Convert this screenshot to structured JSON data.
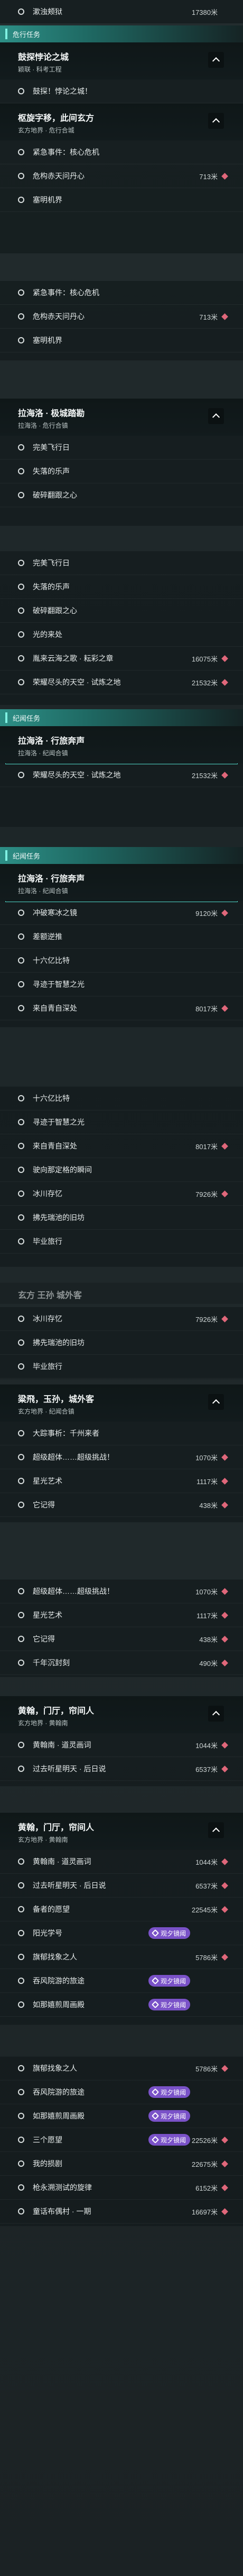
{
  "top": {
    "label": "漱浊颊狱",
    "distance": "17380米"
  },
  "cat1": "危行任务",
  "s1": {
    "title": "鼓探悖论之城",
    "sub": "颖联 · 科考工程",
    "item": "鼓探！悖论之城！"
  },
  "s2": {
    "title": "枢旋字移，此间玄方",
    "sub": "玄方地界 · 危行合城",
    "items": [
      {
        "label": "紧急事件：核心危机",
        "dist": ""
      },
      {
        "label": "危构赤天问丹心",
        "dist": "713米"
      },
      {
        "label": "塞明机界",
        "dist": ""
      }
    ]
  },
  "s2b": {
    "items": [
      {
        "label": "紧急事件：核心危机",
        "dist": ""
      },
      {
        "label": "危构赤天问丹心",
        "dist": "713米"
      },
      {
        "label": "塞明机界",
        "dist": ""
      }
    ]
  },
  "s3": {
    "title": "拉海洛 · 极城踏勘",
    "sub": "拉海洛 · 危行合镇",
    "items": [
      {
        "label": "完美飞行日",
        "dist": ""
      },
      {
        "label": "失落的乐声",
        "dist": ""
      },
      {
        "label": "破碎翻跟之心",
        "dist": ""
      }
    ]
  },
  "s3b": {
    "items": [
      {
        "label": "完美飞行日",
        "dist": ""
      },
      {
        "label": "失落的乐声",
        "dist": ""
      },
      {
        "label": "破碎翻跟之心",
        "dist": ""
      },
      {
        "label": "光的来处",
        "dist": ""
      },
      {
        "label": "胤来云海之歌 · 耘彩之章",
        "dist": "16075米"
      },
      {
        "label": "荣耀尽头的天空 · 试炼之地",
        "dist": "21532米"
      }
    ]
  },
  "cat2": "纪闻任务",
  "s4": {
    "title": "拉海洛 · 行旅奔声",
    "sub": "拉海洛 · 纪闻合镇",
    "items": [
      {
        "label": "荣耀尽头的天空 · 试炼之地",
        "dist": "21532米"
      }
    ]
  },
  "cat3": "纪闻任务",
  "s5": {
    "title": "拉海洛 · 行旅奔声",
    "sub": "拉海洛 · 纪闻合镇",
    "items": [
      {
        "label": "冲破寒冰之镜",
        "dist": "9120米"
      },
      {
        "label": "差额逆推",
        "dist": ""
      },
      {
        "label": "十六亿比特",
        "dist": ""
      },
      {
        "label": "寻迹于智慧之光",
        "dist": ""
      },
      {
        "label": "来自青自深处",
        "dist": "8017米"
      }
    ]
  },
  "s5b": {
    "items": [
      {
        "label": "十六亿比特",
        "dist": ""
      },
      {
        "label": "寻迹于智慧之光",
        "dist": ""
      },
      {
        "label": "来自青自深处",
        "dist": "8017米"
      },
      {
        "label": "驶向那定格的瞬间",
        "dist": ""
      },
      {
        "label": "冰川存忆",
        "dist": "7926米"
      },
      {
        "label": "拂先瑞池的旧坊",
        "dist": ""
      },
      {
        "label": "毕业旅行",
        "dist": ""
      }
    ]
  },
  "s6ghost": {
    "title": "玄方 王孙 城外客"
  },
  "s6pre": {
    "items": [
      {
        "label": "冰川存忆",
        "dist": "7926米"
      },
      {
        "label": "拂先瑞池的旧坊",
        "dist": ""
      },
      {
        "label": "毕业旅行",
        "dist": ""
      }
    ]
  },
  "s6": {
    "title": "粱飛，玉孙，城外客",
    "sub": "玄方地界 · 纪闻合镇",
    "items": [
      {
        "label": "大踪事析：千州来者",
        "dist": ""
      },
      {
        "label": "超级超体……超级挑战！",
        "dist": "1070米"
      },
      {
        "label": "星光艺术",
        "dist": "1117米"
      },
      {
        "label": "它记得",
        "dist": "438米"
      }
    ]
  },
  "s6b": {
    "items": [
      {
        "label": "超级超体……超级挑战！",
        "dist": "1070米"
      },
      {
        "label": "星光艺术",
        "dist": "1117米"
      },
      {
        "label": "它记得",
        "dist": "438米"
      },
      {
        "label": "千年沉封刻",
        "dist": "490米"
      }
    ]
  },
  "s7": {
    "title": "黄翰，门厅，帘间人",
    "sub": "玄方地界 · 黄翰南",
    "items": [
      {
        "label": "黄翰南 · 道灵画词",
        "dist": "1044米"
      },
      {
        "label": "过去听星明天 · 后日说",
        "dist": "6537米"
      }
    ]
  },
  "s7b": {
    "title": "黄翰，门厅，帘间人",
    "sub": "玄方地界 · 黄翰南",
    "items": [
      {
        "label": "黄翰南 · 道灵画词",
        "dist": "1044米",
        "tag": ""
      },
      {
        "label": "过去听星明天 · 后日说",
        "dist": "6537米",
        "tag": ""
      },
      {
        "label": "备者的愿望",
        "dist": "22545米",
        "tag": ""
      },
      {
        "label": "阳光学号",
        "dist": "",
        "tag": "观夕镜阈"
      },
      {
        "label": "旗郁找象之人",
        "dist": "5786米",
        "tag": ""
      },
      {
        "label": "吞风院游的旅途",
        "dist": "",
        "tag": "观夕镜阈"
      },
      {
        "label": "如那嬉煎周画殿",
        "dist": "",
        "tag": "观夕镜阈"
      }
    ]
  },
  "s7c": {
    "items": [
      {
        "label": "旗郁找象之人",
        "dist": "5786米",
        "tag": ""
      },
      {
        "label": "吞风院游的旅途",
        "dist": "",
        "tag": "观夕镜阈"
      },
      {
        "label": "如那嬉煎周画殿",
        "dist": "",
        "tag": "观夕镜阈"
      },
      {
        "label": "三个愿望",
        "dist": "22526米",
        "tag": "观夕镜阈"
      },
      {
        "label": "我的损剧",
        "dist": "22675米",
        "tag": ""
      },
      {
        "label": "枪永溯测试的旋律",
        "dist": "6152米",
        "tag": ""
      },
      {
        "label": "童话布偶村 · 一期",
        "dist": "16697米",
        "tag": ""
      }
    ]
  }
}
